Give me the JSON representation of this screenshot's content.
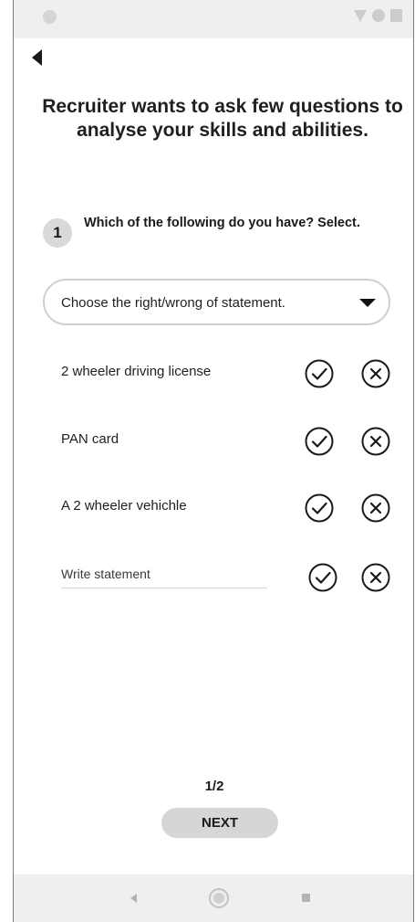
{
  "header": {
    "title": "Recruiter wants to ask few questions to analyse your skills and abilities."
  },
  "question": {
    "number": "1",
    "text": "Which of the following do you have? Select."
  },
  "dropdown": {
    "selected": "Choose the right/wrong of statement."
  },
  "statements": [
    {
      "label": "2 wheeler driving license"
    },
    {
      "label": "PAN card"
    },
    {
      "label": "A 2 wheeler vehichle"
    }
  ],
  "custom_statement": {
    "placeholder": "Write statement",
    "value": ""
  },
  "icons": {
    "back": "back-arrow-icon",
    "dropdown": "caret-down-icon",
    "check": "check-circle-icon",
    "cross": "cross-circle-icon"
  },
  "footer": {
    "page_indicator": "1/2",
    "next_label": "NEXT"
  },
  "colors": {
    "bars": "#efefef",
    "button": "#d6d6d6",
    "badge": "#d9d9d9",
    "text": "#1a1a1a"
  }
}
